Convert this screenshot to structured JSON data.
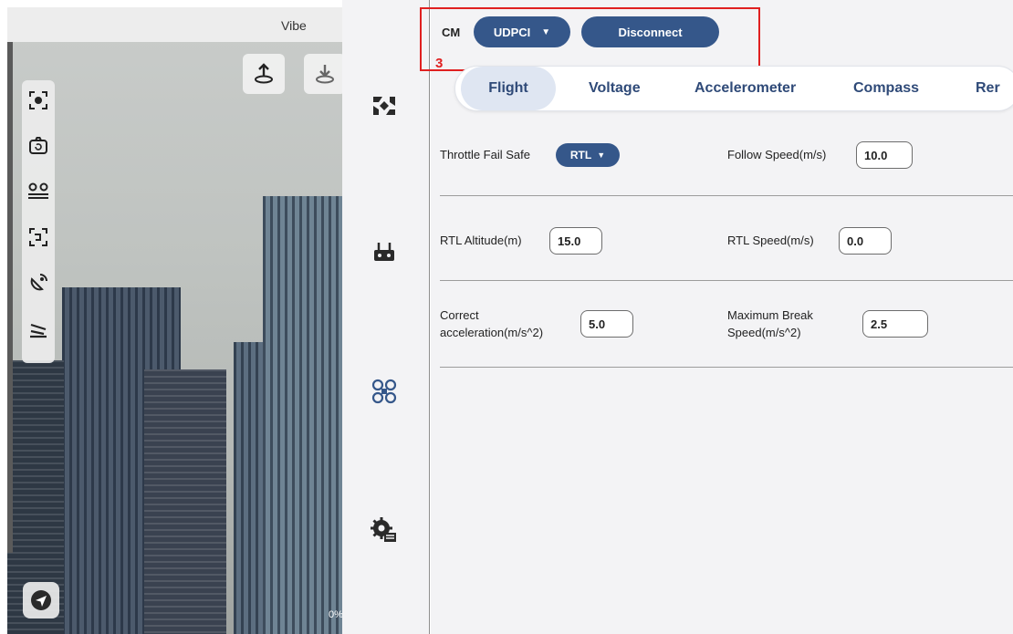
{
  "camera": {
    "app_title": "Vibe",
    "progress_text": "0%",
    "left_tools": [
      "target-lock-icon",
      "camera-rotate-icon",
      "waypoint-route-icon",
      "focus-frame-icon",
      "satellite-dish-icon",
      "landing-icon"
    ],
    "top_buttons": [
      "takeoff-icon",
      "land-icon"
    ]
  },
  "sidebar": {
    "items": [
      "image-transfer-icon",
      "remote-controller-icon",
      "drone-frame-icon",
      "gear-settings-icon"
    ]
  },
  "connection": {
    "cm_label": "CM",
    "protocol_value": "UDPCI",
    "disconnect_label": "Disconnect",
    "annotation_number": "3"
  },
  "tabs": [
    {
      "label": "Flight",
      "active": true
    },
    {
      "label": "Voltage",
      "active": false
    },
    {
      "label": "Accelerometer",
      "active": false
    },
    {
      "label": "Compass",
      "active": false
    },
    {
      "label": "Rer",
      "active": false
    }
  ],
  "form": {
    "throttle_fail_safe_label": "Throttle Fail Safe",
    "throttle_fail_safe_value": "RTL",
    "follow_speed_label": "Follow Speed(m/s)",
    "follow_speed_value": "10.0",
    "rtl_altitude_label": "RTL Altitude(m)",
    "rtl_altitude_value": "15.0",
    "rtl_speed_label": "RTL Speed(m/s)",
    "rtl_speed_value": "0.0",
    "correct_acc_label_1": "Correct",
    "correct_acc_label_2": "acceleration(m/s^2)",
    "correct_acc_value": "5.0",
    "max_break_label_1": "Maximum Break",
    "max_break_label_2": "Speed(m/s^2)",
    "max_break_value": "2.5"
  },
  "colors": {
    "accent": "#35578a",
    "tab_active_bg": "#dfe6f2",
    "annotation": "#e02020"
  }
}
